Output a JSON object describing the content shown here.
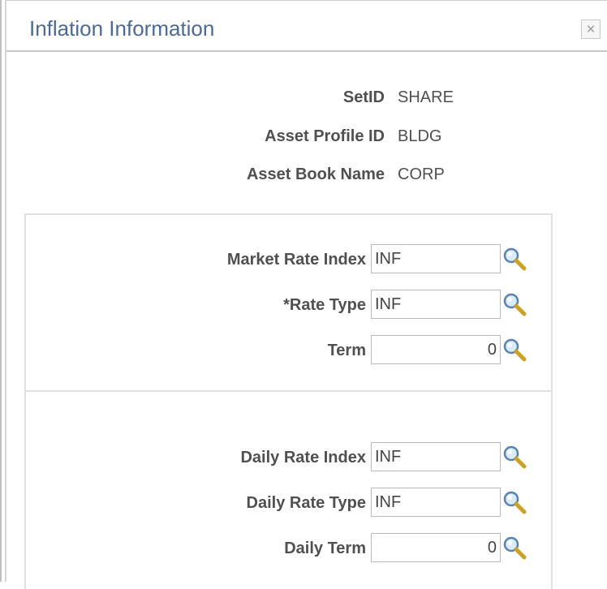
{
  "title": "Inflation Information",
  "close_label": "×",
  "header": [
    {
      "label": "SetID",
      "value": "SHARE"
    },
    {
      "label": "Asset Profile ID",
      "value": "BLDG"
    },
    {
      "label": "Asset Book Name",
      "value": "CORP"
    }
  ],
  "market": {
    "rate_index_label": "Market Rate Index",
    "rate_index_value": "INF",
    "rate_type_label": "*Rate Type",
    "rate_type_value": "INF",
    "term_label": "Term",
    "term_value": "0"
  },
  "daily": {
    "rate_index_label": "Daily Rate Index",
    "rate_index_value": "INF",
    "rate_type_label": "Daily Rate Type",
    "rate_type_value": "INF",
    "term_label": "Daily Term",
    "term_value": "0"
  },
  "icons": {
    "lookup": "magnifier-icon",
    "close": "close-icon"
  },
  "colors": {
    "title": "#4b6a95",
    "label": "#505050",
    "border": "#e0e0e0"
  }
}
